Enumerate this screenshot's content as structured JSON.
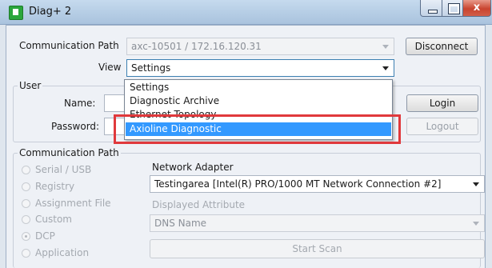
{
  "window": {
    "title": "Diag+ 2",
    "close_glyph": "x"
  },
  "top": {
    "comm_path_label": "Communication Path",
    "comm_path_value": "axc-10501 / 172.16.120.31",
    "disconnect_label": "Disconnect",
    "view_label": "View",
    "view_value": "Settings"
  },
  "view_dropdown": {
    "options": [
      "Settings",
      "Diagnostic Archive",
      "Ethernet Topology",
      "Axioline Diagnostic"
    ],
    "selected": "Axioline Diagnostic"
  },
  "user": {
    "group_label": "User",
    "name_label": "Name:",
    "password_label": "Password:",
    "login_label": "Login",
    "logout_label": "Logout"
  },
  "comm": {
    "group_label": "Communication Path",
    "radios": [
      "Serial / USB",
      "Registry",
      "Assignment File",
      "Custom",
      "DCP",
      "Application"
    ],
    "checked_radio": "DCP",
    "network_adapter_label": "Network Adapter",
    "network_adapter_value": "Testingarea [Intel(R) PRO/1000 MT Network Connection #2]",
    "displayed_attr_label": "Displayed Attribute",
    "displayed_attr_value": "DNS Name",
    "start_scan_label": "Start Scan"
  },
  "colors": {
    "selection": "#3399ff",
    "highlight": "#e0393c",
    "close": "#c9442f"
  }
}
